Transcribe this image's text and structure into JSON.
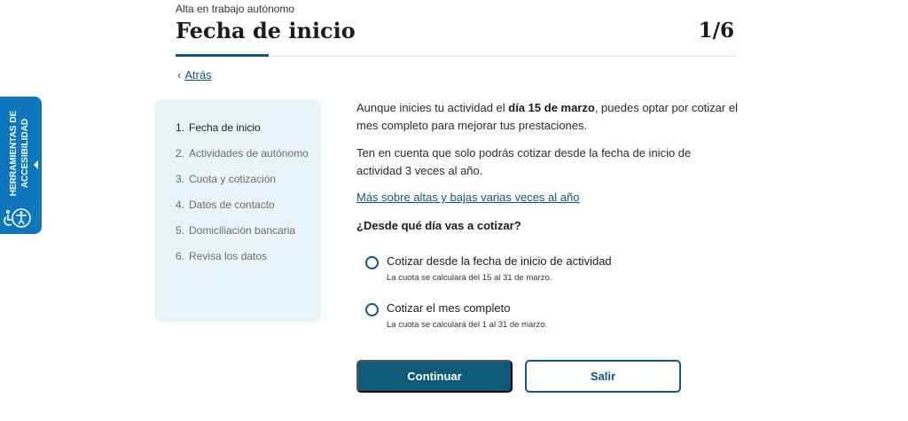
{
  "header": {
    "supertitle": "Alta en trabajo autónomo",
    "title": "Fecha de inicio",
    "step_counter": "1/6",
    "back_label": "Atrás"
  },
  "accessibility": {
    "line1": "HERRAMIENTAS DE",
    "line2": "ACCESIBILIDAD",
    "icon": "accessibility-person-icon",
    "color": "#0d76bd"
  },
  "steps": [
    {
      "num": "1.",
      "label": "Fecha de inicio"
    },
    {
      "num": "2.",
      "label": "Actividades de autónomo"
    },
    {
      "num": "3.",
      "label": "Cuota y cotización"
    },
    {
      "num": "4.",
      "label": "Datos de contacto"
    },
    {
      "num": "5.",
      "label": "Domiciliación bancaria"
    },
    {
      "num": "6.",
      "label": "Revisa los datos"
    }
  ],
  "main": {
    "intro_before": "Aunque inicies tu actividad el ",
    "intro_bold": "día 15 de marzo",
    "intro_after": ", puedes optar por cotizar el mes completo para mejorar tus prestaciones.",
    "notice": "Ten en cuenta que solo podrás cotizar desde la fecha de inicio de actividad 3 veces al año.",
    "more_link": "Más sobre altas y bajas varias veces al año",
    "question": "¿Desde qué día vas a cotizar?",
    "options": [
      {
        "label": "Cotizar desde la fecha de inicio de actividad",
        "hint": "La cuota se calculará del 15 al 31 de marzo."
      },
      {
        "label": "Cotizar el mes completo",
        "hint": "La cuota se calculará del 1 al 31 de marzo."
      }
    ]
  },
  "buttons": {
    "continue": "Continuar",
    "exit": "Salir"
  },
  "colors": {
    "primary": "#0c5a78",
    "panel_bg": "#e8f5f8"
  }
}
